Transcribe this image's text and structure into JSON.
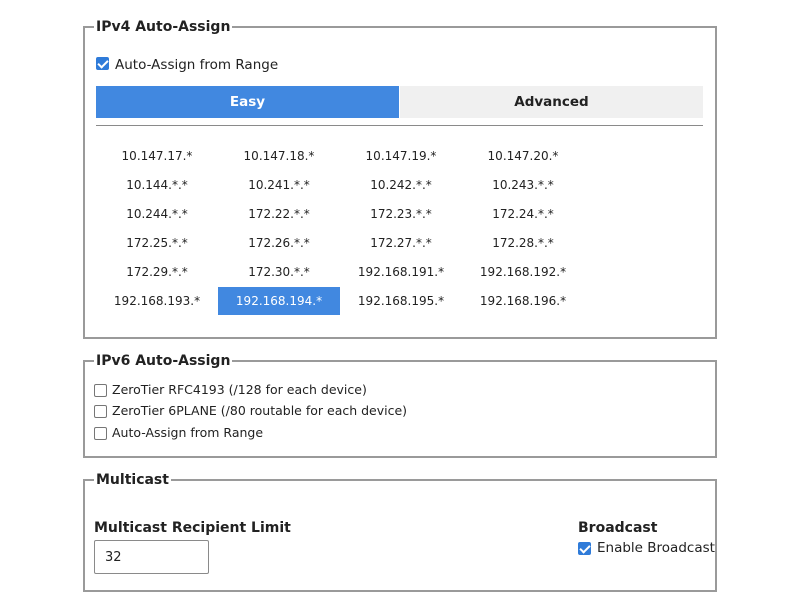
{
  "ipv4": {
    "legend": "IPv4 Auto-Assign",
    "auto_assign": {
      "label": "Auto-Assign from Range",
      "checked": true
    },
    "tabs": [
      {
        "label": "Easy",
        "active": true
      },
      {
        "label": "Advanced",
        "active": false
      }
    ],
    "ranges": [
      [
        "10.147.17.*",
        "10.147.18.*",
        "10.147.19.*",
        "10.147.20.*"
      ],
      [
        "10.144.*.*",
        "10.241.*.*",
        "10.242.*.*",
        "10.243.*.*"
      ],
      [
        "10.244.*.*",
        "172.22.*.*",
        "172.23.*.*",
        "172.24.*.*"
      ],
      [
        "172.25.*.*",
        "172.26.*.*",
        "172.27.*.*",
        "172.28.*.*"
      ],
      [
        "172.29.*.*",
        "172.30.*.*",
        "192.168.191.*",
        "192.168.192.*"
      ],
      [
        "192.168.193.*",
        "192.168.194.*",
        "192.168.195.*",
        "192.168.196.*"
      ]
    ],
    "selected_range": "192.168.194.*"
  },
  "ipv6": {
    "legend": "IPv6 Auto-Assign",
    "options": [
      {
        "label": "ZeroTier RFC4193 (/128 for each device)",
        "checked": false
      },
      {
        "label": "ZeroTier 6PLANE (/80 routable for each device)",
        "checked": false
      },
      {
        "label": "Auto-Assign from Range",
        "checked": false
      }
    ]
  },
  "multicast": {
    "legend": "Multicast",
    "recipient_limit": {
      "label": "Multicast Recipient Limit",
      "value": "32"
    },
    "broadcast": {
      "heading": "Broadcast",
      "label": "Enable Broadcast",
      "checked": true
    }
  },
  "colors": {
    "accent": "#4188e0",
    "checkbox": "#2f7bd9",
    "tab_inactive": "#f0f0f0",
    "border": "#9a9a9a"
  }
}
